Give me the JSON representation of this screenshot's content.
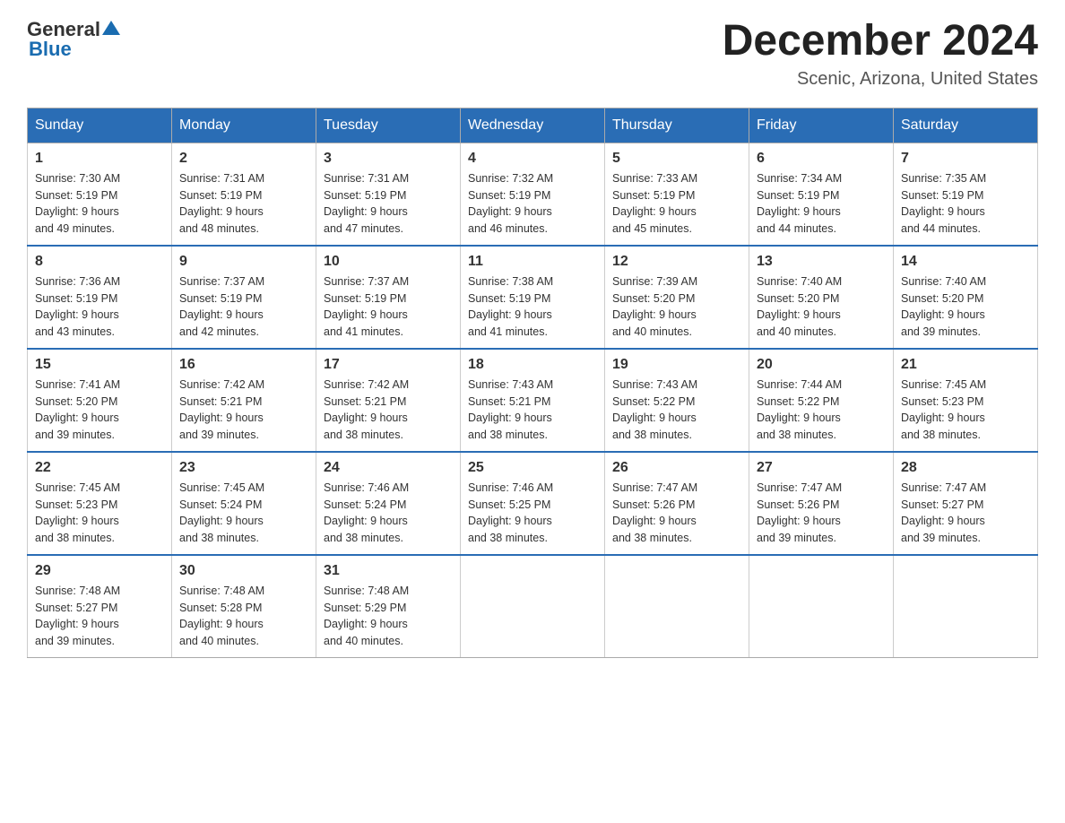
{
  "header": {
    "logo_general": "General",
    "logo_blue": "Blue",
    "month_title": "December 2024",
    "location": "Scenic, Arizona, United States"
  },
  "days_of_week": [
    "Sunday",
    "Monday",
    "Tuesday",
    "Wednesday",
    "Thursday",
    "Friday",
    "Saturday"
  ],
  "weeks": [
    [
      {
        "day": "1",
        "sunrise": "7:30 AM",
        "sunset": "5:19 PM",
        "daylight": "9 hours and 49 minutes."
      },
      {
        "day": "2",
        "sunrise": "7:31 AM",
        "sunset": "5:19 PM",
        "daylight": "9 hours and 48 minutes."
      },
      {
        "day": "3",
        "sunrise": "7:31 AM",
        "sunset": "5:19 PM",
        "daylight": "9 hours and 47 minutes."
      },
      {
        "day": "4",
        "sunrise": "7:32 AM",
        "sunset": "5:19 PM",
        "daylight": "9 hours and 46 minutes."
      },
      {
        "day": "5",
        "sunrise": "7:33 AM",
        "sunset": "5:19 PM",
        "daylight": "9 hours and 45 minutes."
      },
      {
        "day": "6",
        "sunrise": "7:34 AM",
        "sunset": "5:19 PM",
        "daylight": "9 hours and 44 minutes."
      },
      {
        "day": "7",
        "sunrise": "7:35 AM",
        "sunset": "5:19 PM",
        "daylight": "9 hours and 44 minutes."
      }
    ],
    [
      {
        "day": "8",
        "sunrise": "7:36 AM",
        "sunset": "5:19 PM",
        "daylight": "9 hours and 43 minutes."
      },
      {
        "day": "9",
        "sunrise": "7:37 AM",
        "sunset": "5:19 PM",
        "daylight": "9 hours and 42 minutes."
      },
      {
        "day": "10",
        "sunrise": "7:37 AM",
        "sunset": "5:19 PM",
        "daylight": "9 hours and 41 minutes."
      },
      {
        "day": "11",
        "sunrise": "7:38 AM",
        "sunset": "5:19 PM",
        "daylight": "9 hours and 41 minutes."
      },
      {
        "day": "12",
        "sunrise": "7:39 AM",
        "sunset": "5:20 PM",
        "daylight": "9 hours and 40 minutes."
      },
      {
        "day": "13",
        "sunrise": "7:40 AM",
        "sunset": "5:20 PM",
        "daylight": "9 hours and 40 minutes."
      },
      {
        "day": "14",
        "sunrise": "7:40 AM",
        "sunset": "5:20 PM",
        "daylight": "9 hours and 39 minutes."
      }
    ],
    [
      {
        "day": "15",
        "sunrise": "7:41 AM",
        "sunset": "5:20 PM",
        "daylight": "9 hours and 39 minutes."
      },
      {
        "day": "16",
        "sunrise": "7:42 AM",
        "sunset": "5:21 PM",
        "daylight": "9 hours and 39 minutes."
      },
      {
        "day": "17",
        "sunrise": "7:42 AM",
        "sunset": "5:21 PM",
        "daylight": "9 hours and 38 minutes."
      },
      {
        "day": "18",
        "sunrise": "7:43 AM",
        "sunset": "5:21 PM",
        "daylight": "9 hours and 38 minutes."
      },
      {
        "day": "19",
        "sunrise": "7:43 AM",
        "sunset": "5:22 PM",
        "daylight": "9 hours and 38 minutes."
      },
      {
        "day": "20",
        "sunrise": "7:44 AM",
        "sunset": "5:22 PM",
        "daylight": "9 hours and 38 minutes."
      },
      {
        "day": "21",
        "sunrise": "7:45 AM",
        "sunset": "5:23 PM",
        "daylight": "9 hours and 38 minutes."
      }
    ],
    [
      {
        "day": "22",
        "sunrise": "7:45 AM",
        "sunset": "5:23 PM",
        "daylight": "9 hours and 38 minutes."
      },
      {
        "day": "23",
        "sunrise": "7:45 AM",
        "sunset": "5:24 PM",
        "daylight": "9 hours and 38 minutes."
      },
      {
        "day": "24",
        "sunrise": "7:46 AM",
        "sunset": "5:24 PM",
        "daylight": "9 hours and 38 minutes."
      },
      {
        "day": "25",
        "sunrise": "7:46 AM",
        "sunset": "5:25 PM",
        "daylight": "9 hours and 38 minutes."
      },
      {
        "day": "26",
        "sunrise": "7:47 AM",
        "sunset": "5:26 PM",
        "daylight": "9 hours and 38 minutes."
      },
      {
        "day": "27",
        "sunrise": "7:47 AM",
        "sunset": "5:26 PM",
        "daylight": "9 hours and 39 minutes."
      },
      {
        "day": "28",
        "sunrise": "7:47 AM",
        "sunset": "5:27 PM",
        "daylight": "9 hours and 39 minutes."
      }
    ],
    [
      {
        "day": "29",
        "sunrise": "7:48 AM",
        "sunset": "5:27 PM",
        "daylight": "9 hours and 39 minutes."
      },
      {
        "day": "30",
        "sunrise": "7:48 AM",
        "sunset": "5:28 PM",
        "daylight": "9 hours and 40 minutes."
      },
      {
        "day": "31",
        "sunrise": "7:48 AM",
        "sunset": "5:29 PM",
        "daylight": "9 hours and 40 minutes."
      },
      null,
      null,
      null,
      null
    ]
  ],
  "labels": {
    "sunrise": "Sunrise:",
    "sunset": "Sunset:",
    "daylight": "Daylight:"
  }
}
